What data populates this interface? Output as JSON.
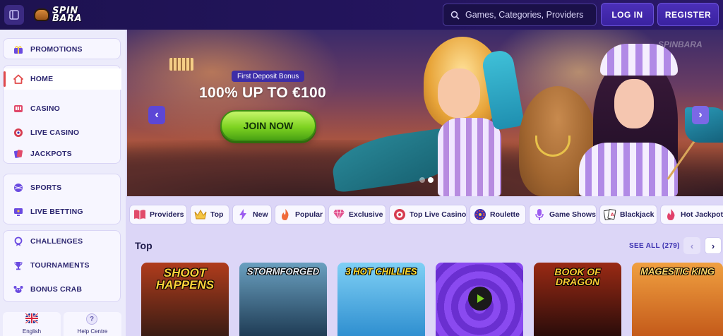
{
  "header": {
    "logo_line1": "SPIN",
    "logo_line2": "BARA",
    "search_placeholder": "Games, Categories, Providers",
    "login_label": "LOG IN",
    "register_label": "REGISTER"
  },
  "sidebar": {
    "groups": [
      {
        "items": [
          {
            "label": "PROMOTIONS",
            "icon": "gift-icon"
          }
        ]
      },
      {
        "items": [
          {
            "label": "HOME",
            "icon": "home-icon",
            "active": true
          },
          {
            "label": "CASINO",
            "icon": "slot-machine-icon"
          },
          {
            "label": "LIVE CASINO",
            "icon": "chip-icon"
          },
          {
            "label": "JACKPOTS",
            "icon": "cards-icon"
          }
        ]
      },
      {
        "items": [
          {
            "label": "SPORTS",
            "icon": "ball-icon"
          },
          {
            "label": "LIVE BETTING",
            "icon": "monitor-icon"
          }
        ]
      },
      {
        "items": [
          {
            "label": "CHALLENGES",
            "icon": "medal-icon"
          },
          {
            "label": "TOURNAMENTS",
            "icon": "trophy-icon"
          },
          {
            "label": "BONUS CRAB",
            "icon": "crab-icon"
          }
        ]
      }
    ],
    "bottom": [
      {
        "label": "English",
        "icon": "uk-flag-icon"
      },
      {
        "label": "Help Centre",
        "icon": "help-icon"
      }
    ]
  },
  "banner": {
    "badge": "First Deposit Bonus",
    "headline": "100% UP TO €100",
    "cta": "JOIN NOW",
    "watermark": "SPINBARA",
    "slides_count": 2,
    "active_slide": 2
  },
  "categories": [
    {
      "label": "Providers",
      "icon": "book-icon"
    },
    {
      "label": "Top",
      "icon": "crown-icon"
    },
    {
      "label": "New",
      "icon": "lightning-icon"
    },
    {
      "label": "Popular",
      "icon": "flame-icon"
    },
    {
      "label": "Exclusive",
      "icon": "diamond-icon"
    },
    {
      "label": "Top Live Casino",
      "icon": "chip-icon"
    },
    {
      "label": "Roulette",
      "icon": "roulette-icon"
    },
    {
      "label": "Game Shows",
      "icon": "microphone-icon"
    },
    {
      "label": "Blackjack",
      "icon": "cards-icon"
    },
    {
      "label": "Hot Jackpots",
      "icon": "hot-icon"
    }
  ],
  "top_section": {
    "title": "Top",
    "see_all": "SEE ALL (279)",
    "games": [
      {
        "title": "SHOOT HAPPENS",
        "colors": [
          "#3a1c14",
          "#b03c1c"
        ]
      },
      {
        "title": "STORMFORGED",
        "colors": [
          "#1f3c55",
          "#6aa0c0"
        ]
      },
      {
        "title": "3 HOT CHILLIES",
        "colors": [
          "#2f8fd0",
          "#7fd0f5"
        ]
      },
      {
        "title": "",
        "colors": [
          "#7a3be0",
          "#b27cf7"
        ]
      },
      {
        "title": "BOOK OF DRAGON",
        "colors": [
          "#2a0c0a",
          "#9a2a14"
        ]
      },
      {
        "title": "MAGESTIC KING",
        "colors": [
          "#c45a1a",
          "#f0a040"
        ]
      }
    ]
  },
  "colors": {
    "topbar": "#1d1250",
    "accent": "#4b2fb8",
    "cta_green": "#7ed321",
    "active_marker": "#e14b4b"
  }
}
